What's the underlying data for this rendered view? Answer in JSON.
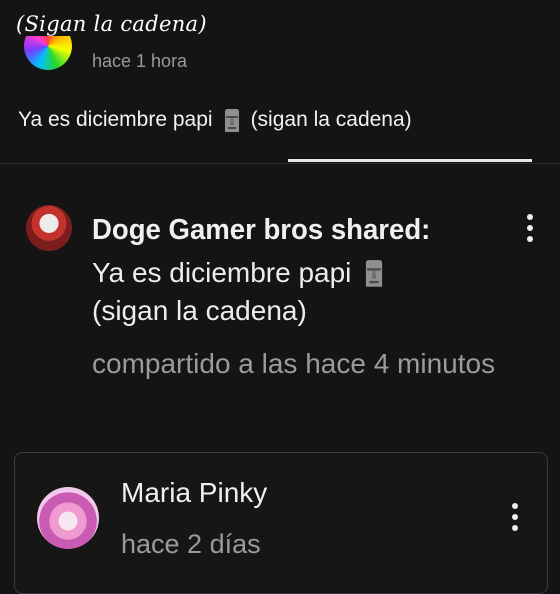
{
  "caption": "(Sigan la cadena)",
  "original_post": {
    "time": "hace 1 hora",
    "text_before": "Ya es diciembre papi",
    "text_after": "(sigan la cadena)",
    "emoji_icon": "moai-icon"
  },
  "shared_post": {
    "title": "Doge Gamer bros shared:",
    "line1": "Ya es diciembre papi",
    "line2": "(sigan la cadena)",
    "meta": "compartido a las hace 4 minutos",
    "emoji_icon": "moai-icon",
    "menu_icon": "more-vertical-icon"
  },
  "comment": {
    "author": "Maria Pinky",
    "time": "hace 2 días",
    "menu_icon": "more-vertical-icon"
  },
  "colors": {
    "background": "#141414",
    "text": "#e9e9e9",
    "muted": "#9b9b9b"
  }
}
